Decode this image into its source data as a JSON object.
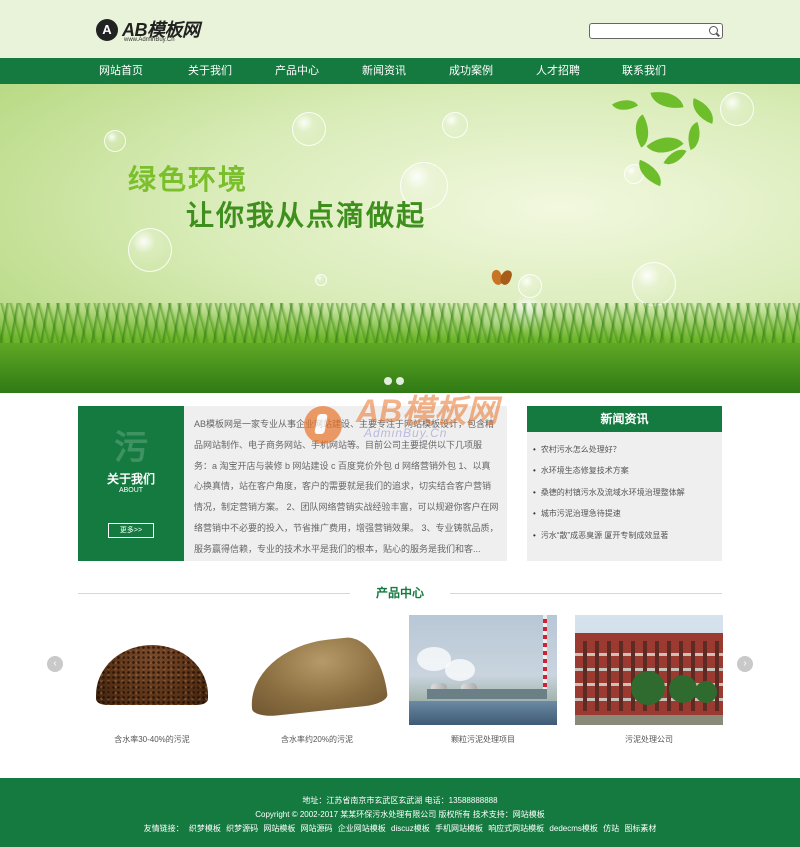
{
  "header": {
    "logo_letters": "A",
    "logo_name": "AB模板网",
    "logo_sub": "www.AdminBuy.Cn",
    "search_placeholder": ""
  },
  "nav": [
    {
      "label": "网站首页"
    },
    {
      "label": "关于我们"
    },
    {
      "label": "产品中心"
    },
    {
      "label": "新闻资讯"
    },
    {
      "label": "成功案例"
    },
    {
      "label": "人才招聘"
    },
    {
      "label": "联系我们"
    }
  ],
  "banner": {
    "slogan_line1": "绿色环境",
    "slogan_line2": "让你我从点滴做起"
  },
  "about": {
    "watermark": "污",
    "title": "关于我们",
    "title_en": "ABOUT",
    "more_label": "更多>>",
    "text": "AB模板网是一家专业从事企业网站建设、主要专注于网站模板设计，包含精品网站制作、电子商务网站、手机网站等。目前公司主要提供以下几项服务：a 淘宝开店与装修 b 网站建设 c 百度竞价外包 d 网络营销外包 1、以真心换真情，站在客户角度，客户的需要就是我们的追求，切实结合客户营销情况，制定营销方案。 2、团队网络营销实战经验丰富，可以规避你客户在网络营销中不必要的投入，节省推广费用，增强营销效果。 3、专业铸就品质，服务赢得信赖，专业的技术水平是我们的根本，贴心的服务是我们和客..."
  },
  "watermark_overlay": {
    "name": "AB模板网",
    "sub": "AdminBuy.Cn"
  },
  "news": {
    "title": "新闻资讯",
    "items": [
      "农村污水怎么处理好？",
      "水环境生态修复技术方案",
      "桑德的村镇污水及流域水环境治理整体解",
      "城市污泥治理急待提速",
      "污水“散”成恶臭源 厦开专制成效显著"
    ]
  },
  "products": {
    "title": "产品中心",
    "prev_label": "‹",
    "next_label": "›",
    "items": [
      {
        "caption": "含水率30-40%的污泥"
      },
      {
        "caption": "含水率约20%的污泥"
      },
      {
        "caption": "颗粒污泥处理项目"
      },
      {
        "caption": "污泥处理公司"
      }
    ]
  },
  "footer": {
    "address": "地址：江苏省南京市玄武区玄武湖  电话：13588888888",
    "copyright": "Copyright © 2002-2017 某某环保污水处理有限公司 版权所有  技术支持：网站模板",
    "links_label": "友情链接：",
    "links": [
      "织梦模板",
      "织梦源码",
      "网站模板",
      "网站源码",
      "企业网站模板",
      "discuz模板",
      "手机网站模板",
      "响应式网站模板",
      "dedecms模板",
      "仿站",
      "图标素材"
    ]
  },
  "colors": {
    "brand_green": "#157a40",
    "header_bg": "#e9f3d9",
    "panel_gray": "#efefef"
  }
}
